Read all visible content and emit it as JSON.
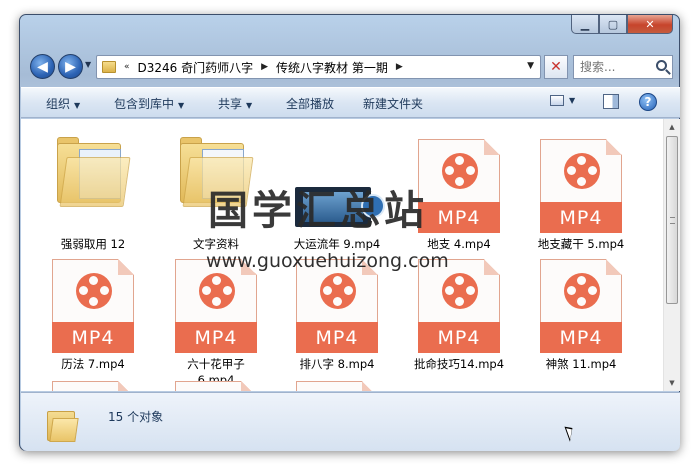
{
  "window": {
    "controls": {
      "minimize": "▁",
      "maximize": "▢",
      "close": "✕"
    }
  },
  "nav": {
    "back": "◀",
    "forward": "▶",
    "dropdown": "▼",
    "address_prefix": "«",
    "breadcrumb": [
      "D3246 奇门药师八字",
      "传统八字教材 第一期"
    ],
    "separator": "▶",
    "address_dropdown": "▼",
    "refresh": "✕",
    "search_placeholder": "搜索..."
  },
  "toolbar": {
    "organize": "组织",
    "include_in_library": "包含到库中",
    "share": "共享",
    "play_all": "全部播放",
    "new_folder": "新建文件夹",
    "arrow": "▼",
    "help": "?"
  },
  "files": [
    {
      "name": "强弱取用 12",
      "type": "folder"
    },
    {
      "name": "文字资料",
      "type": "folder"
    },
    {
      "name": "大运流年 9.mp4",
      "type": "video"
    },
    {
      "name": "地支 4.mp4",
      "type": "mp4"
    },
    {
      "name": "地支藏干 5.mp4",
      "type": "mp4"
    },
    {
      "name": "历法 7.mp4",
      "type": "mp4"
    },
    {
      "name": "六十花甲子 6.mp4",
      "type": "mp4"
    },
    {
      "name": "排八字 8.mp4",
      "type": "mp4"
    },
    {
      "name": "批命技巧14.mp4",
      "type": "mp4"
    },
    {
      "name": "神煞 11.mp4",
      "type": "mp4"
    }
  ],
  "file_badge": "MP4",
  "watermark": {
    "text": "国学汇总站",
    "url": "www.guoxuehuizong.com"
  },
  "status": {
    "count_text": "15 个对象"
  },
  "colors": {
    "mp4_accent": "#ea6d4f",
    "toolbar_text": "#1e395b"
  }
}
